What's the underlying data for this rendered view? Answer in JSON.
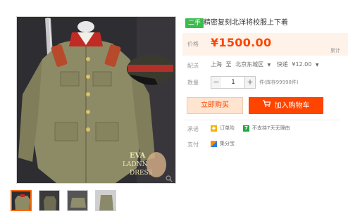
{
  "product": {
    "badge": "二手",
    "title": "精密复刻北洋将校服上下着"
  },
  "gallery": {
    "watermark_line1": "EVA",
    "watermark_line2": "LADNN",
    "watermark_line3": "DRESS",
    "thumbnail_count": 4,
    "active_thumbnail": 1
  },
  "price": {
    "label": "价格",
    "value": "¥1500.00",
    "side_text": "累计"
  },
  "shipping": {
    "label": "配送",
    "from": "上海",
    "to_word": "至",
    "destination": "北京东城区",
    "method": "快递",
    "fee": "¥12.00"
  },
  "quantity": {
    "label": "数量",
    "minus": "−",
    "value": "1",
    "plus": "+",
    "stock": "件(库存99998件)"
  },
  "actions": {
    "buy_now": "立即购买",
    "add_to_cart": "加入购物车"
  },
  "promise": {
    "label": "承诺",
    "guarantee": "订单险",
    "no_return": "不支持7天无理由"
  },
  "payment": {
    "label": "支付",
    "method": "集分宝"
  },
  "colors": {
    "accent": "#ff4400",
    "used_badge": "#3dbb4e",
    "price_panel": "#fff2e8"
  }
}
